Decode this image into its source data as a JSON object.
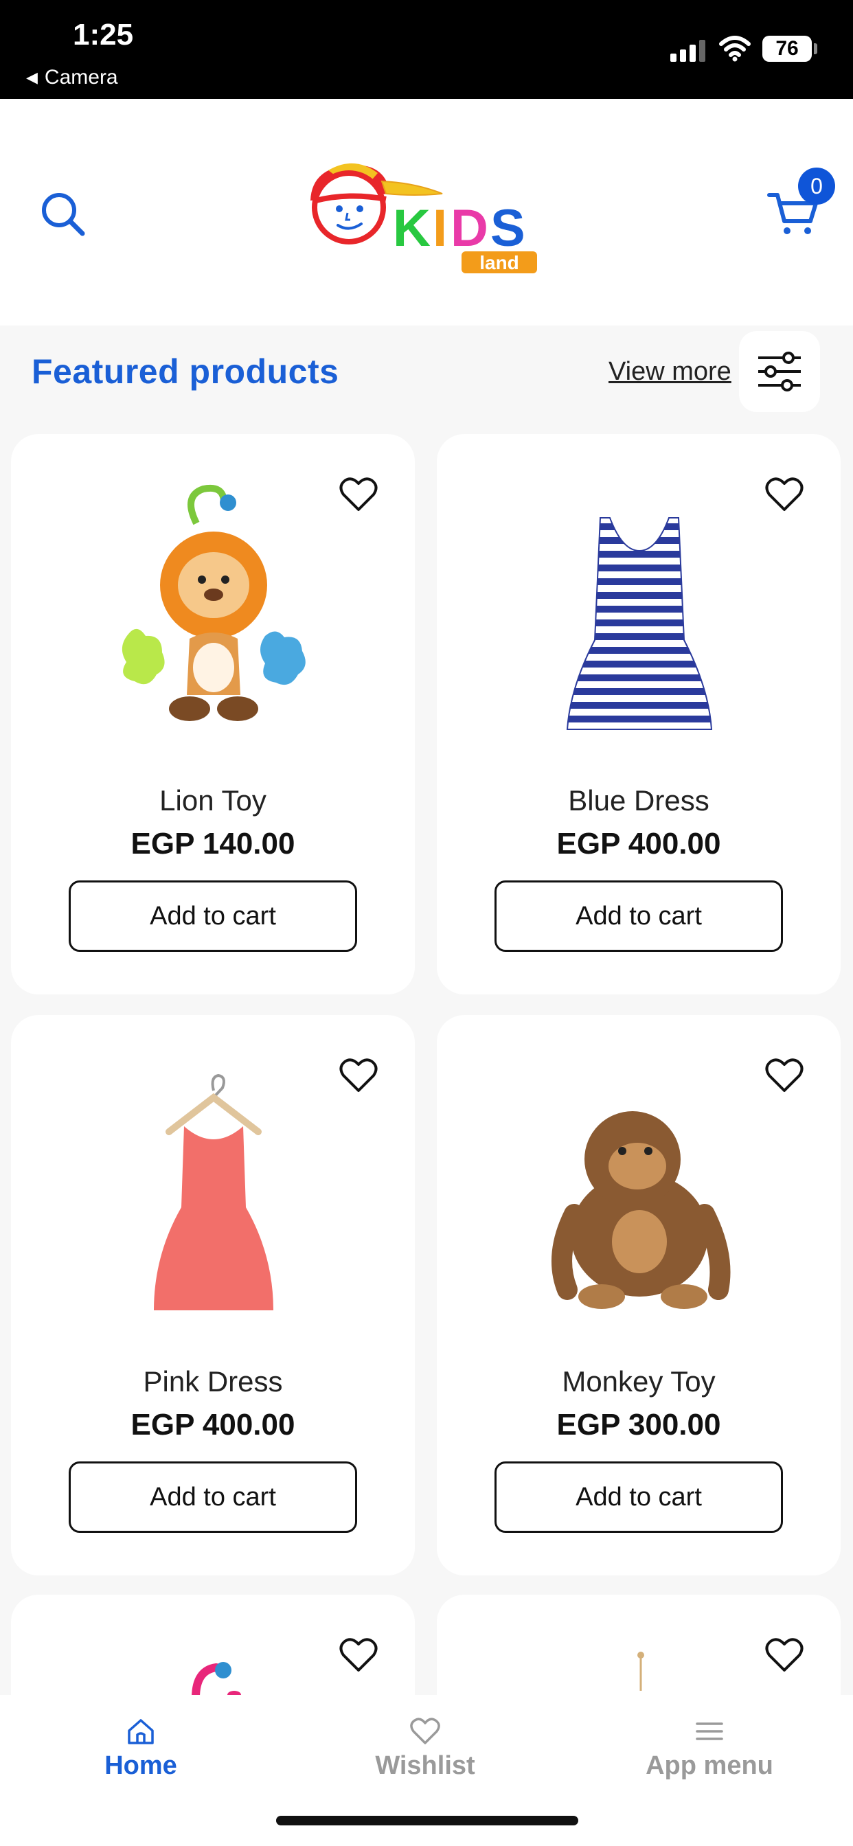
{
  "status_bar": {
    "time": "1:25",
    "back_app": "Camera",
    "battery": "76"
  },
  "header": {
    "logo_text": "KIDS",
    "logo_subtext": "land",
    "cart_count": "0"
  },
  "section": {
    "title": "Featured products",
    "view_more": "View more"
  },
  "products": [
    {
      "name": "Lion Toy",
      "price": "EGP 140.00",
      "button": "Add to cart",
      "image": "lion-toy-image"
    },
    {
      "name": "Blue Dress",
      "price": "EGP 400.00",
      "button": "Add to cart",
      "image": "blue-dress-image"
    },
    {
      "name": "Pink Dress",
      "price": "EGP 400.00",
      "button": "Add to cart",
      "image": "pink-dress-image"
    },
    {
      "name": "Monkey Toy",
      "price": "EGP 300.00",
      "button": "Add to cart",
      "image": "monkey-toy-image"
    }
  ],
  "bottom_nav": {
    "home": "Home",
    "wishlist": "Wishlist",
    "menu": "App menu"
  },
  "colors": {
    "accent": "#1a5fd6",
    "badge": "#0f55d8",
    "inactive": "#9a9a9a"
  }
}
